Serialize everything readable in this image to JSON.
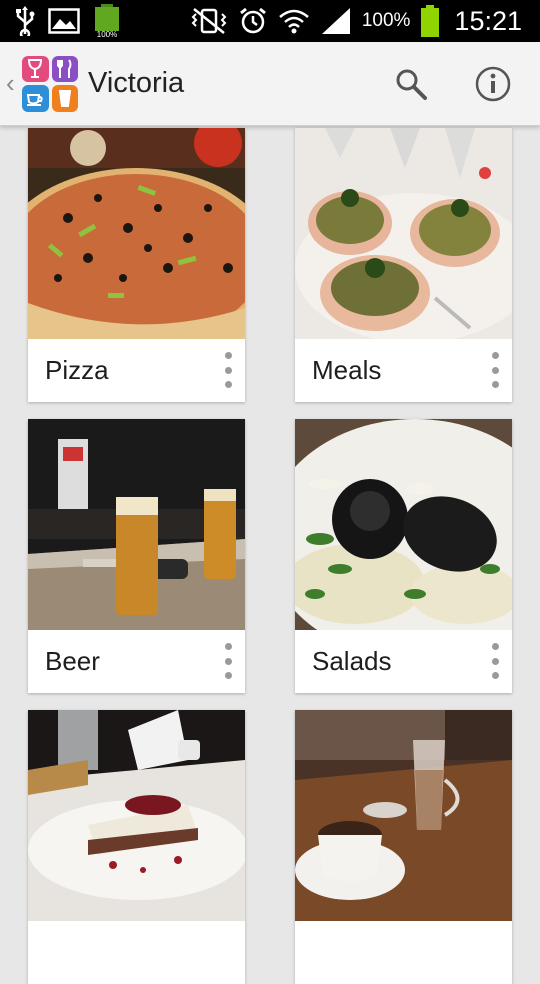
{
  "status_bar": {
    "battery_small_label": "100%",
    "battery_percent": "100%",
    "time": "15:21"
  },
  "action_bar": {
    "title": "Victoria",
    "icons": [
      "back-chevron-icon",
      "app-logo-icon",
      "search-icon",
      "info-icon"
    ]
  },
  "categories": [
    {
      "label": "Pizza"
    },
    {
      "label": "Meals"
    },
    {
      "label": "Beer"
    },
    {
      "label": "Salads"
    },
    {
      "label": ""
    },
    {
      "label": ""
    }
  ],
  "colors": {
    "status_bar_bg": "#000000",
    "action_bar_bg": "#f3f3f3",
    "page_bg": "#e7e7e7",
    "battery_green": "#8fd400"
  }
}
